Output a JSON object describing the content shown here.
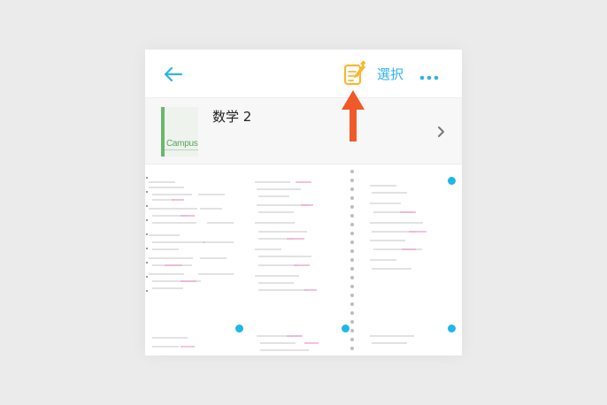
{
  "header": {
    "back_icon": "arrow-left-icon",
    "edit_icon": "note-edit-icon",
    "select_label": "選択",
    "more_icon": "more-horizontal-icon"
  },
  "annotation": {
    "icon": "arrow-up-icon",
    "color": "#f05a28"
  },
  "notebook": {
    "title": "数学 2",
    "cover_brand": "Campus",
    "cover_color": "#69b76e"
  },
  "colors": {
    "accent": "#2fb3e8",
    "edit_icon": "#f7b733",
    "selection_dot": "#1fb6ee",
    "handwriting": "#555555",
    "handwriting_highlight": "#e05aa8"
  }
}
